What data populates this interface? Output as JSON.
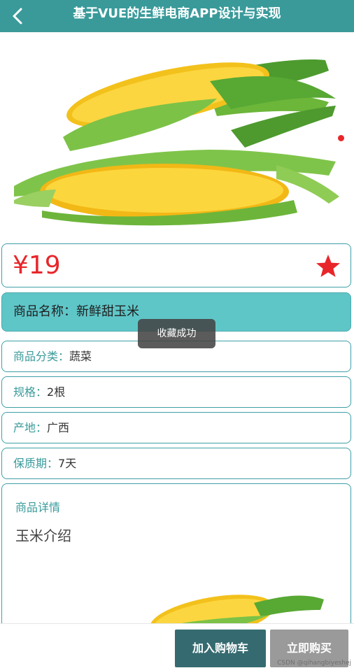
{
  "header": {
    "title": "基于VUE的生鲜电商APP设计与实现",
    "back_icon": "chevron-left-icon"
  },
  "product": {
    "price": "¥19",
    "favorite_icon": "star-icon",
    "favorite_color": "#e8262a",
    "name_line": "商品名称：新鲜甜玉米",
    "rows": [
      {
        "label": "商品分类：",
        "value": "蔬菜"
      },
      {
        "label": "规格：",
        "value": "2根"
      },
      {
        "label": "产地：",
        "value": "广西"
      },
      {
        "label": "保质期：",
        "value": "7天"
      }
    ],
    "detail_title": "商品详情",
    "detail_text": "玉米介绍"
  },
  "toast": "收藏成功",
  "footer": {
    "cart_label": "加入购物车",
    "buy_label": "立即购买"
  },
  "watermark": "CSDN @qihangbiyeshej",
  "colors": {
    "accent": "#3a9a9a",
    "name_bar": "#5fc6c8",
    "price": "#e8262a"
  }
}
